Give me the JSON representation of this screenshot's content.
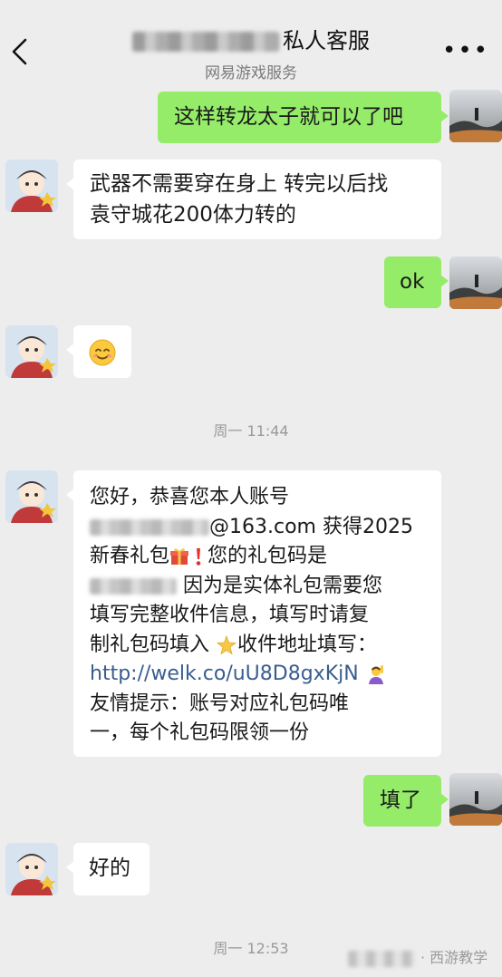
{
  "header": {
    "title": "私人客服",
    "subtitle": "网易游戏服务",
    "back_icon": "chevron-left-icon",
    "more_icon": "more-icon"
  },
  "messages": [
    {
      "side": "me",
      "text": "这样转龙太子就可以了吧"
    },
    {
      "side": "them",
      "lines": [
        "武器不需要穿在身上 转完以后找",
        "袁守城花200体力转的"
      ]
    },
    {
      "side": "me",
      "text": "ok"
    },
    {
      "side": "them",
      "emoji": "smile-emoji-icon"
    },
    {
      "side": "them",
      "lines": [
        "您好，恭喜您本人账号",
        "@163.com 获得2025",
        "新春礼包",
        "您的礼包码是",
        "因为是实体礼包需要您",
        "填写完整收件信息，填写时请复",
        "制礼包码填入",
        "收件地址填写：",
        "http://welk.co/uU8D8gxKjN",
        "友情提示：账号对应礼包码唯",
        "一，每个礼包码限领一份"
      ]
    },
    {
      "side": "me",
      "text": "填了"
    },
    {
      "side": "them",
      "text": "好的"
    }
  ],
  "timestamps": [
    "周一 11:44",
    "周一 12:53"
  ],
  "watermark": "· 西游教学",
  "colors": {
    "background": "#ededed",
    "my_bubble": "#95ec69",
    "their_bubble": "#ffffff",
    "link": "#3a5d8f"
  }
}
